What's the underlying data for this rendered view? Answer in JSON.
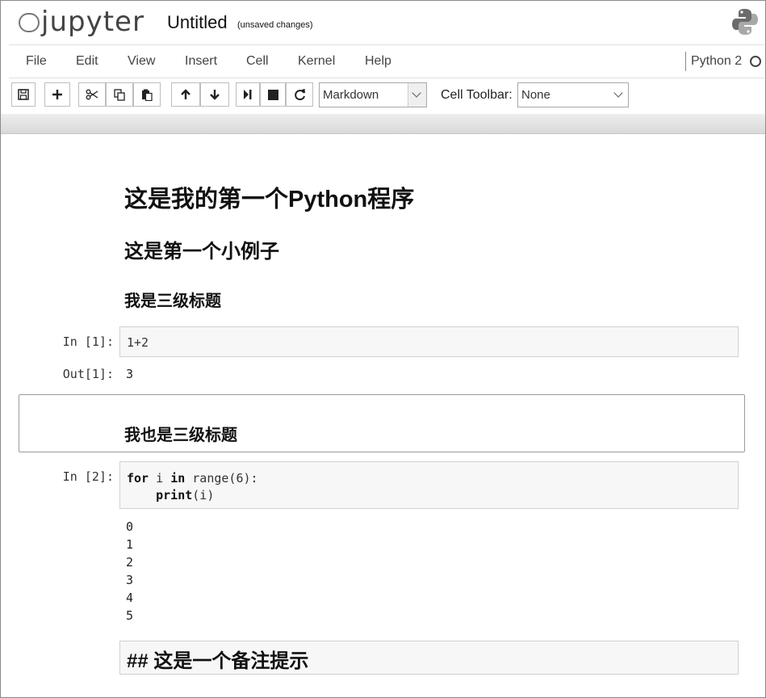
{
  "header": {
    "logo_text": "jupyter",
    "notebook_title": "Untitled",
    "save_status": "(unsaved changes)"
  },
  "menubar": {
    "items": [
      "File",
      "Edit",
      "View",
      "Insert",
      "Cell",
      "Kernel",
      "Help"
    ],
    "kernel_name": "Python 2"
  },
  "toolbar": {
    "cell_type_value": "Markdown",
    "cell_toolbar_label": "Cell Toolbar:",
    "cell_toolbar_value": "None",
    "icons": [
      "save-icon",
      "plus-icon",
      "scissors-icon",
      "copy-icon",
      "paste-icon",
      "arrow-up-icon",
      "arrow-down-icon",
      "step-forward-icon",
      "stop-icon",
      "restart-icon"
    ]
  },
  "cells": {
    "heading1": "这是我的第一个Python程序",
    "heading2": "这是第一个小例子",
    "heading3": "我是三级标题",
    "code1": {
      "prompt": "In [1]:",
      "source": "1+2",
      "out_prompt": "Out[1]:",
      "output": "3"
    },
    "heading3b": "我也是三级标题",
    "code2": {
      "prompt": "In [2]:",
      "line1_kw1": "for",
      "line1_mid": " i ",
      "line1_kw2": "in",
      "line1_rest": " range(6):",
      "line2_indent": "    ",
      "line2_kw": "print",
      "line2_rest": "(i)",
      "outputs": [
        "0",
        "1",
        "2",
        "3",
        "4",
        "5"
      ]
    },
    "raw_markdown": "## 这是一个备注提示"
  }
}
